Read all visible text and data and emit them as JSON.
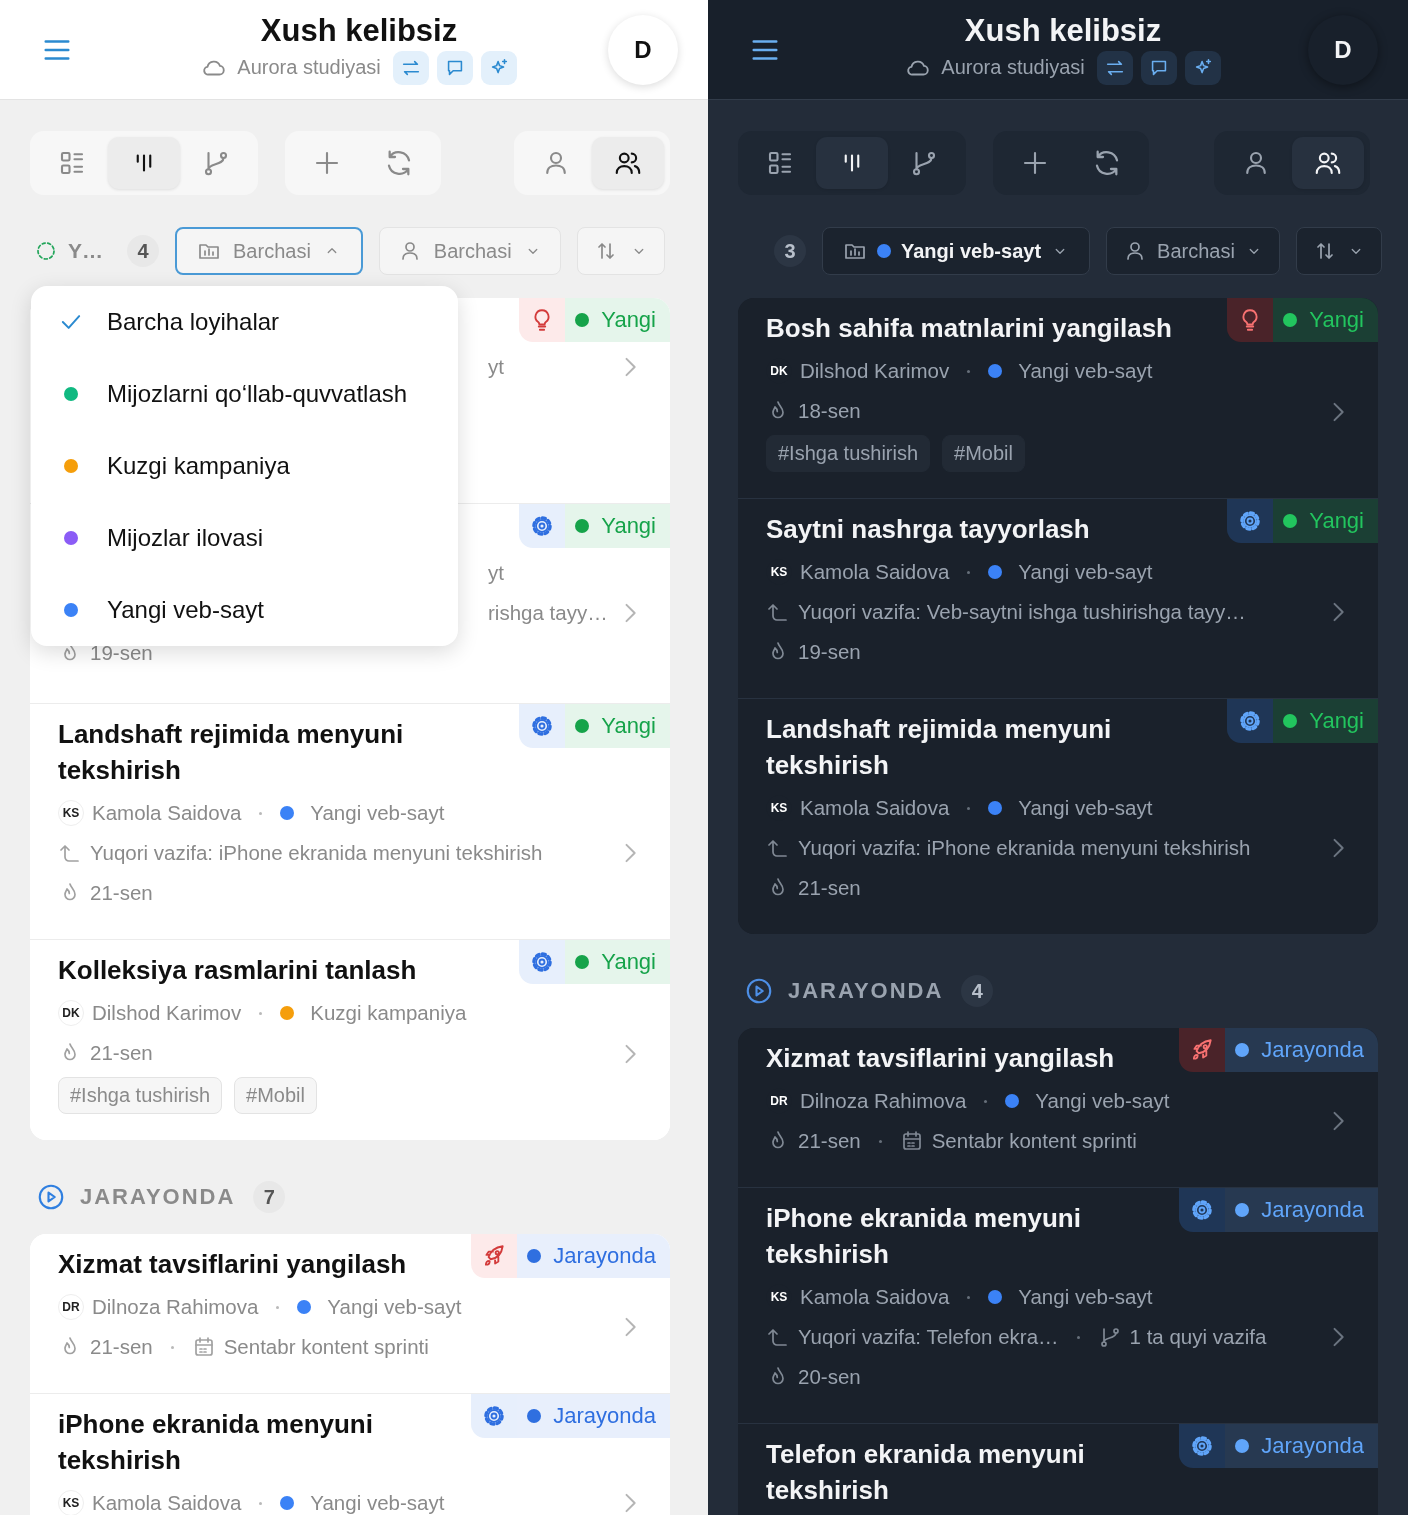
{
  "screens": [
    {
      "dark_mode": false,
      "header": {
        "title": "Xush kelibsiz",
        "workspace": "Aurora studiyasi",
        "avatar": "D"
      },
      "toolbar": {
        "views": [
          {
            "selected": false
          },
          {
            "selected": true
          },
          {
            "selected": false
          }
        ],
        "scopes": [
          {
            "selected": false
          },
          {
            "selected": true
          }
        ]
      },
      "filters": {
        "status": {
          "label": "Y…"
        },
        "count": "4",
        "project": {
          "label": "Barchasi",
          "expanded": true
        },
        "assignee": {
          "label": "Barchasi",
          "expanded": false
        }
      },
      "project_menu": [
        {
          "label": "Barcha loyihalar",
          "selected": true
        },
        {
          "label": "Mijozlarni qo‘llab-quvvatlash",
          "selected": false,
          "color": "#10b981"
        },
        {
          "label": "Kuzgi kampaniya",
          "selected": false,
          "color": "#f59e0b"
        },
        {
          "label": "Mijozlar ilovasi",
          "selected": false,
          "color": "#8b5cf6"
        },
        {
          "label": "Yangi veb-sayt",
          "selected": false,
          "color": "#3b82f6"
        }
      ],
      "groups": [
        {
          "cards": [
            {
              "badge": {
                "kind": "idea",
                "status": "Yangi",
                "color": "#16a34a"
              },
              "fragments": [
                "yt"
              ]
            },
            {
              "badge": {
                "kind": "task",
                "status": "Yangi",
                "color": "#16a34a"
              },
              "fragments": [
                "yt",
                "rishga tayy…"
              ],
              "date": "19-sen"
            },
            {
              "title": "Landshaft rejimida menyuni tekshirish",
              "badge": {
                "kind": "task",
                "status": "Yangi",
                "color": "#16a34a"
              },
              "assignee": {
                "initials": "KS",
                "name": "Kamola Saidova"
              },
              "project": {
                "name": "Yangi veb-sayt",
                "color": "#3b82f6"
              },
              "parent": "Yuqori vazifa: iPhone ekranida menyuni tekshirish",
              "date": "21-sen"
            },
            {
              "title": "Kolleksiya rasmlarini tanlash",
              "badge": {
                "kind": "task",
                "status": "Yangi",
                "color": "#16a34a"
              },
              "assignee": {
                "initials": "DK",
                "name": "Dilshod Karimov"
              },
              "project": {
                "name": "Kuzgi kampaniya",
                "color": "#f59e0b"
              },
              "date": "21-sen",
              "tags": [
                "#Ishga tushirish",
                "#Mobil"
              ]
            }
          ]
        },
        {
          "title": "JARAYONDA",
          "count": "7",
          "cards": [
            {
              "title": "Xizmat tavsiflarini yangilash",
              "badge": {
                "kind": "release",
                "status": "Jarayonda",
                "color": "#2f6fe0"
              },
              "assignee": {
                "initials": "DR",
                "name": "Dilnoza Rahimova"
              },
              "project": {
                "name": "Yangi veb-sayt",
                "color": "#3b82f6"
              },
              "date": "21-sen",
              "sprint": "Sentabr kontent sprinti"
            },
            {
              "title": "iPhone ekranida menyuni tekshirish",
              "badge": {
                "kind": "task",
                "status": "Jarayonda",
                "color": "#2f6fe0"
              },
              "assignee": {
                "initials": "KS",
                "name": "Kamola Saidova"
              },
              "project": {
                "name": "Yangi veb-sayt",
                "color": "#3b82f6"
              }
            }
          ]
        }
      ]
    },
    {
      "dark_mode": true,
      "header": {
        "title": "Xush kelibsiz",
        "workspace": "Aurora studiyasi",
        "avatar": "D"
      },
      "toolbar": {
        "views": [
          {
            "selected": false
          },
          {
            "selected": true
          },
          {
            "selected": false
          }
        ],
        "scopes": [
          {
            "selected": false
          },
          {
            "selected": true
          }
        ]
      },
      "filters": {
        "count": "3",
        "project": {
          "label": "Yangi veb-sayt",
          "expanded": false,
          "color": "#3b82f6"
        },
        "assignee": {
          "label": "Barchasi",
          "expanded": false
        }
      },
      "groups": [
        {
          "cards": [
            {
              "title": "Bosh sahifa matnlarini yangilash",
              "badge": {
                "kind": "idea",
                "status": "Yangi",
                "color": "#22c55e"
              },
              "assignee": {
                "initials": "DK",
                "name": "Dilshod Karimov"
              },
              "project": {
                "name": "Yangi veb-sayt",
                "color": "#3b82f6"
              },
              "date": "18-sen",
              "tags": [
                "#Ishga tushirish",
                "#Mobil"
              ]
            },
            {
              "title": "Saytni nashrga tayyorlash",
              "badge": {
                "kind": "task",
                "status": "Yangi",
                "color": "#22c55e"
              },
              "assignee": {
                "initials": "KS",
                "name": "Kamola Saidova"
              },
              "project": {
                "name": "Yangi veb-sayt",
                "color": "#3b82f6"
              },
              "parent": "Yuqori vazifa: Veb-saytni ishga tushirishga tayy…",
              "date": "19-sen"
            },
            {
              "title": "Landshaft rejimida menyuni tekshirish",
              "badge": {
                "kind": "task",
                "status": "Yangi",
                "color": "#22c55e"
              },
              "assignee": {
                "initials": "KS",
                "name": "Kamola Saidova"
              },
              "project": {
                "name": "Yangi veb-sayt",
                "color": "#3b82f6"
              },
              "parent": "Yuqori vazifa: iPhone ekranida menyuni tekshirish",
              "date": "21-sen"
            }
          ]
        },
        {
          "title": "JARAYONDA",
          "count": "4",
          "cards": [
            {
              "title": "Xizmat tavsiflarini yangilash",
              "badge": {
                "kind": "release",
                "status": "Jarayonda",
                "color": "#60a5fa"
              },
              "assignee": {
                "initials": "DR",
                "name": "Dilnoza Rahimova"
              },
              "project": {
                "name": "Yangi veb-sayt",
                "color": "#3b82f6"
              },
              "date": "21-sen",
              "sprint": "Sentabr kontent sprinti"
            },
            {
              "title": "iPhone ekranida menyuni tekshirish",
              "badge": {
                "kind": "task",
                "status": "Jarayonda",
                "color": "#60a5fa"
              },
              "assignee": {
                "initials": "KS",
                "name": "Kamola Saidova"
              },
              "project": {
                "name": "Yangi veb-sayt",
                "color": "#3b82f6"
              },
              "parent": "Yuqori vazifa: Telefon ekra…",
              "subtasks": "1 ta quyi vazifa",
              "date": "20-sen"
            },
            {
              "title": "Telefon ekranida menyuni tekshirish",
              "badge": {
                "kind": "task",
                "status": "Jarayonda",
                "color": "#60a5fa"
              }
            }
          ]
        }
      ]
    }
  ]
}
